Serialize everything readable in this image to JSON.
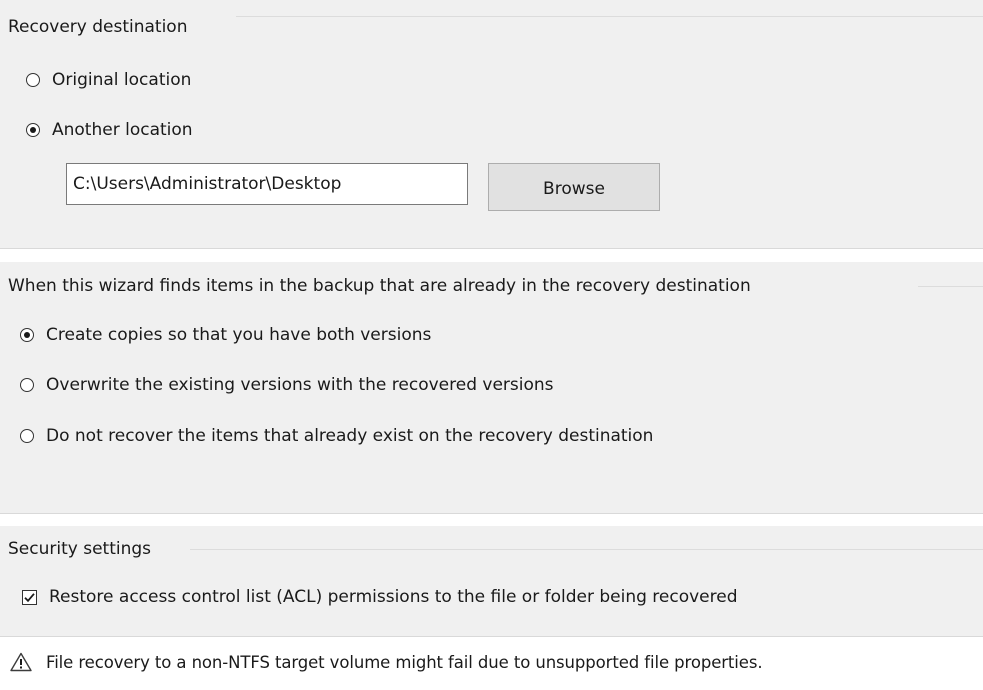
{
  "recovery_destination": {
    "label": "Recovery destination",
    "options": [
      {
        "label": "Original location",
        "checked": false
      },
      {
        "label": "Another location",
        "checked": true
      }
    ],
    "path_value": "C:\\Users\\Administrator\\Desktop",
    "browse_label": "Browse"
  },
  "conflict": {
    "label": "When this wizard finds items in the backup that are already in the recovery destination",
    "options": [
      {
        "label": "Create copies so that you have both versions",
        "checked": true
      },
      {
        "label": "Overwrite the existing versions with the recovered versions",
        "checked": false
      },
      {
        "label": "Do not recover the items that already exist on the recovery destination",
        "checked": false
      }
    ]
  },
  "security": {
    "label": "Security settings",
    "acl_label": "Restore access control list (ACL) permissions to the file or folder being recovered",
    "acl_checked": true
  },
  "warning": {
    "icon": "warning-icon",
    "text": "File recovery to a non-NTFS target volume might fail due to unsupported file properties."
  }
}
